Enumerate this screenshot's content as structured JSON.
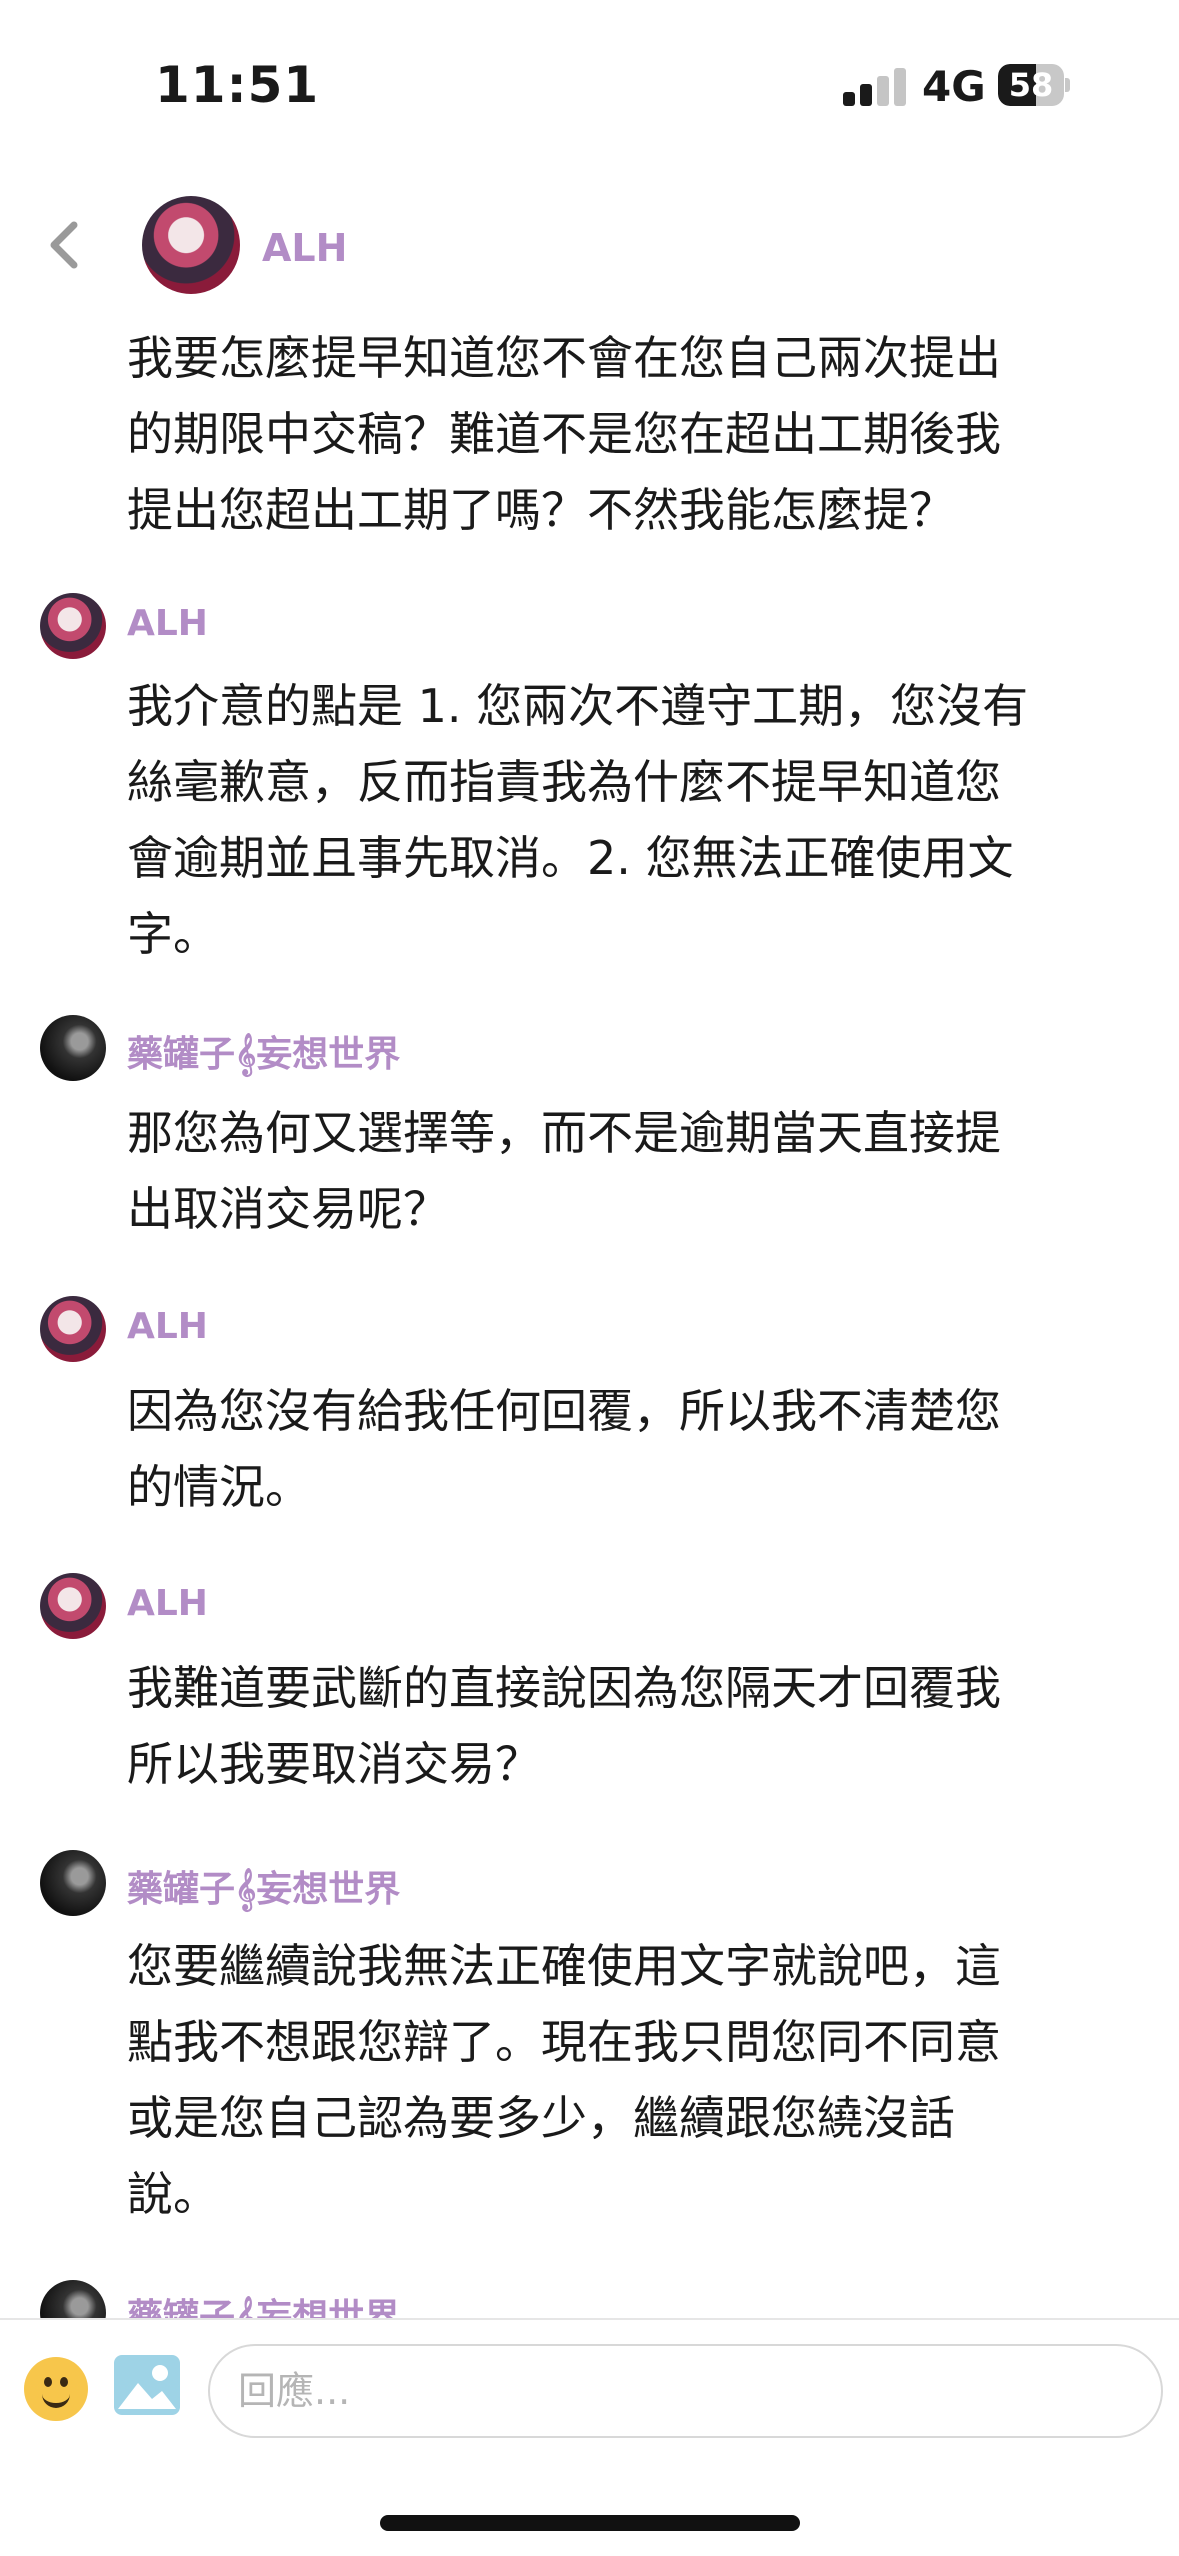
{
  "status_bar": {
    "time": "11:51",
    "network": "4G",
    "battery_percent": "58",
    "battery_level": 0.58
  },
  "header": {
    "contact_name": "ALH"
  },
  "colors": {
    "sender_name": "#b28cc6",
    "text": "#1a1a1a",
    "background": "#ffffff"
  },
  "messages": [
    {
      "sender": "",
      "text": "我要怎麼提早知道您不會在您自己兩次提出\n的期限中交稿？難道不是您在超出工期後我\n提出您超出工期了嗎？不然我能怎麼提？"
    },
    {
      "sender": "ALH",
      "text": "我介意的點是 1. 您兩次不遵守工期，您沒有\n絲毫歉意，反而指責我為什麼不提早知道您\n會逾期並且事先取消。2. 您無法正確使用文\n字。"
    },
    {
      "sender": "藥罐子𝄞妄想世界",
      "text": "那您為何又選擇等，而不是逾期當天直接提\n出取消交易呢？"
    },
    {
      "sender": "ALH",
      "text": "因為您沒有給我任何回覆，所以我不清楚您\n的情況。"
    },
    {
      "sender": "ALH",
      "text": "我難道要武斷的直接說因為您隔天才回覆我\n所以我要取消交易？"
    },
    {
      "sender": "藥罐子𝄞妄想世界",
      "text": "您要繼續說我無法正確使用文字就說吧，這\n點我不想跟您辯了。現在我只問您同不同意\n或是您自己認為要多少，繼續跟您繞沒話\n說。"
    },
    {
      "sender": "藥罐子𝄞妄想世界",
      "text": ""
    }
  ],
  "composer": {
    "placeholder": "回應..."
  }
}
